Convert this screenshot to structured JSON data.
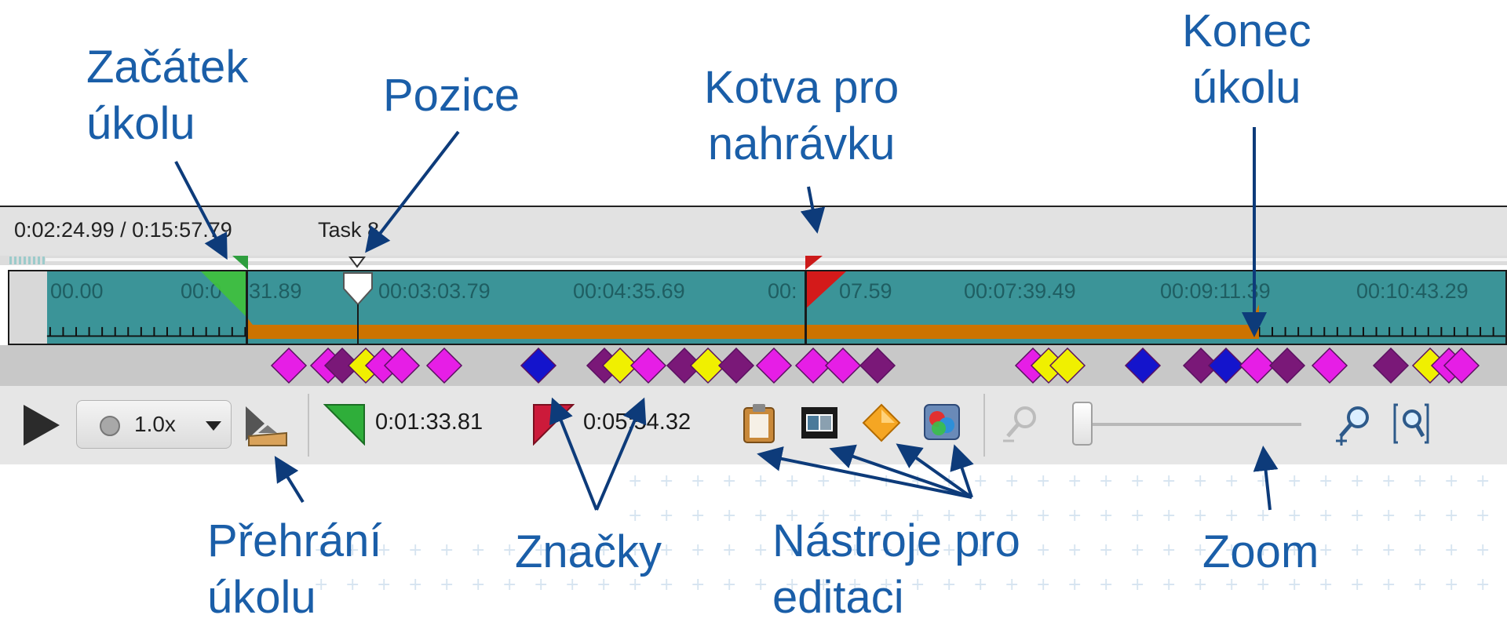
{
  "callouts": {
    "task_start": "Začátek\núkolu",
    "position": "Pozice",
    "anchor": "Kotva pro\nnahrávku",
    "task_end": "Konec\núkolu",
    "playback": "Přehrání\núkolu",
    "markers": "Značky",
    "edit_tools": "Nástroje pro\neditaci",
    "zoom": "Zoom"
  },
  "info_bar": {
    "time": "0:02:24.99 / 0:15:57.79",
    "task": "Task 8"
  },
  "ruler": {
    "labels": [
      "00.00",
      "00:0",
      "31.89",
      "00:03:03.79",
      "00:04:35.69",
      "00:",
      "07.59",
      "00:07:39.49",
      "00:09:11.39",
      "00:10:43.29"
    ]
  },
  "toolbar": {
    "speed": "1.0x",
    "start_time": "0:01:33.81",
    "end_time": "0:05:54.32"
  },
  "icons": {
    "play": "play-icon",
    "speed_dropdown": "chevron-down-icon",
    "play_task": "play-task-icon",
    "start_flag": "start-flag-icon",
    "end_flag": "end-flag-icon",
    "clipboard": "clipboard-icon",
    "film": "film-strip-icon",
    "marker_diamond": "diamond-marker-icon",
    "effects": "effects-icon",
    "zoom_out": "zoom-out-icon",
    "zoom_in": "zoom-in-icon",
    "zoom_fit": "zoom-fit-icon"
  },
  "colors": {
    "callout_text": "#1a5ea8",
    "arrow": "#0d3b7a",
    "timeline_teal": "#3b9498",
    "task_range": "#cc7300",
    "start_flag": "#2e9e3e",
    "end_flag": "#cc1a1a",
    "marker_magenta": "#e61ee6",
    "marker_purple": "#7a1878",
    "marker_yellow": "#f0f000",
    "marker_blue": "#1414cc"
  },
  "markers": [
    {
      "color": "magenta"
    },
    {
      "color": "magenta"
    },
    {
      "color": "purple"
    },
    {
      "color": "yellow"
    },
    {
      "color": "magenta"
    },
    {
      "color": "magenta"
    },
    {
      "color": "magenta"
    },
    {
      "color": "blue"
    },
    {
      "color": "purple"
    },
    {
      "color": "yellow"
    },
    {
      "color": "magenta"
    },
    {
      "color": "purple"
    },
    {
      "color": "yellow"
    },
    {
      "color": "purple"
    },
    {
      "color": "magenta"
    },
    {
      "color": "magenta"
    },
    {
      "color": "magenta"
    },
    {
      "color": "purple"
    },
    {
      "color": "magenta"
    },
    {
      "color": "yellow"
    },
    {
      "color": "yellow"
    },
    {
      "color": "blue"
    },
    {
      "color": "purple"
    },
    {
      "color": "blue"
    },
    {
      "color": "magenta"
    },
    {
      "color": "purple"
    },
    {
      "color": "magenta"
    },
    {
      "color": "purple"
    },
    {
      "color": "yellow"
    },
    {
      "color": "magenta"
    },
    {
      "color": "magenta"
    }
  ]
}
